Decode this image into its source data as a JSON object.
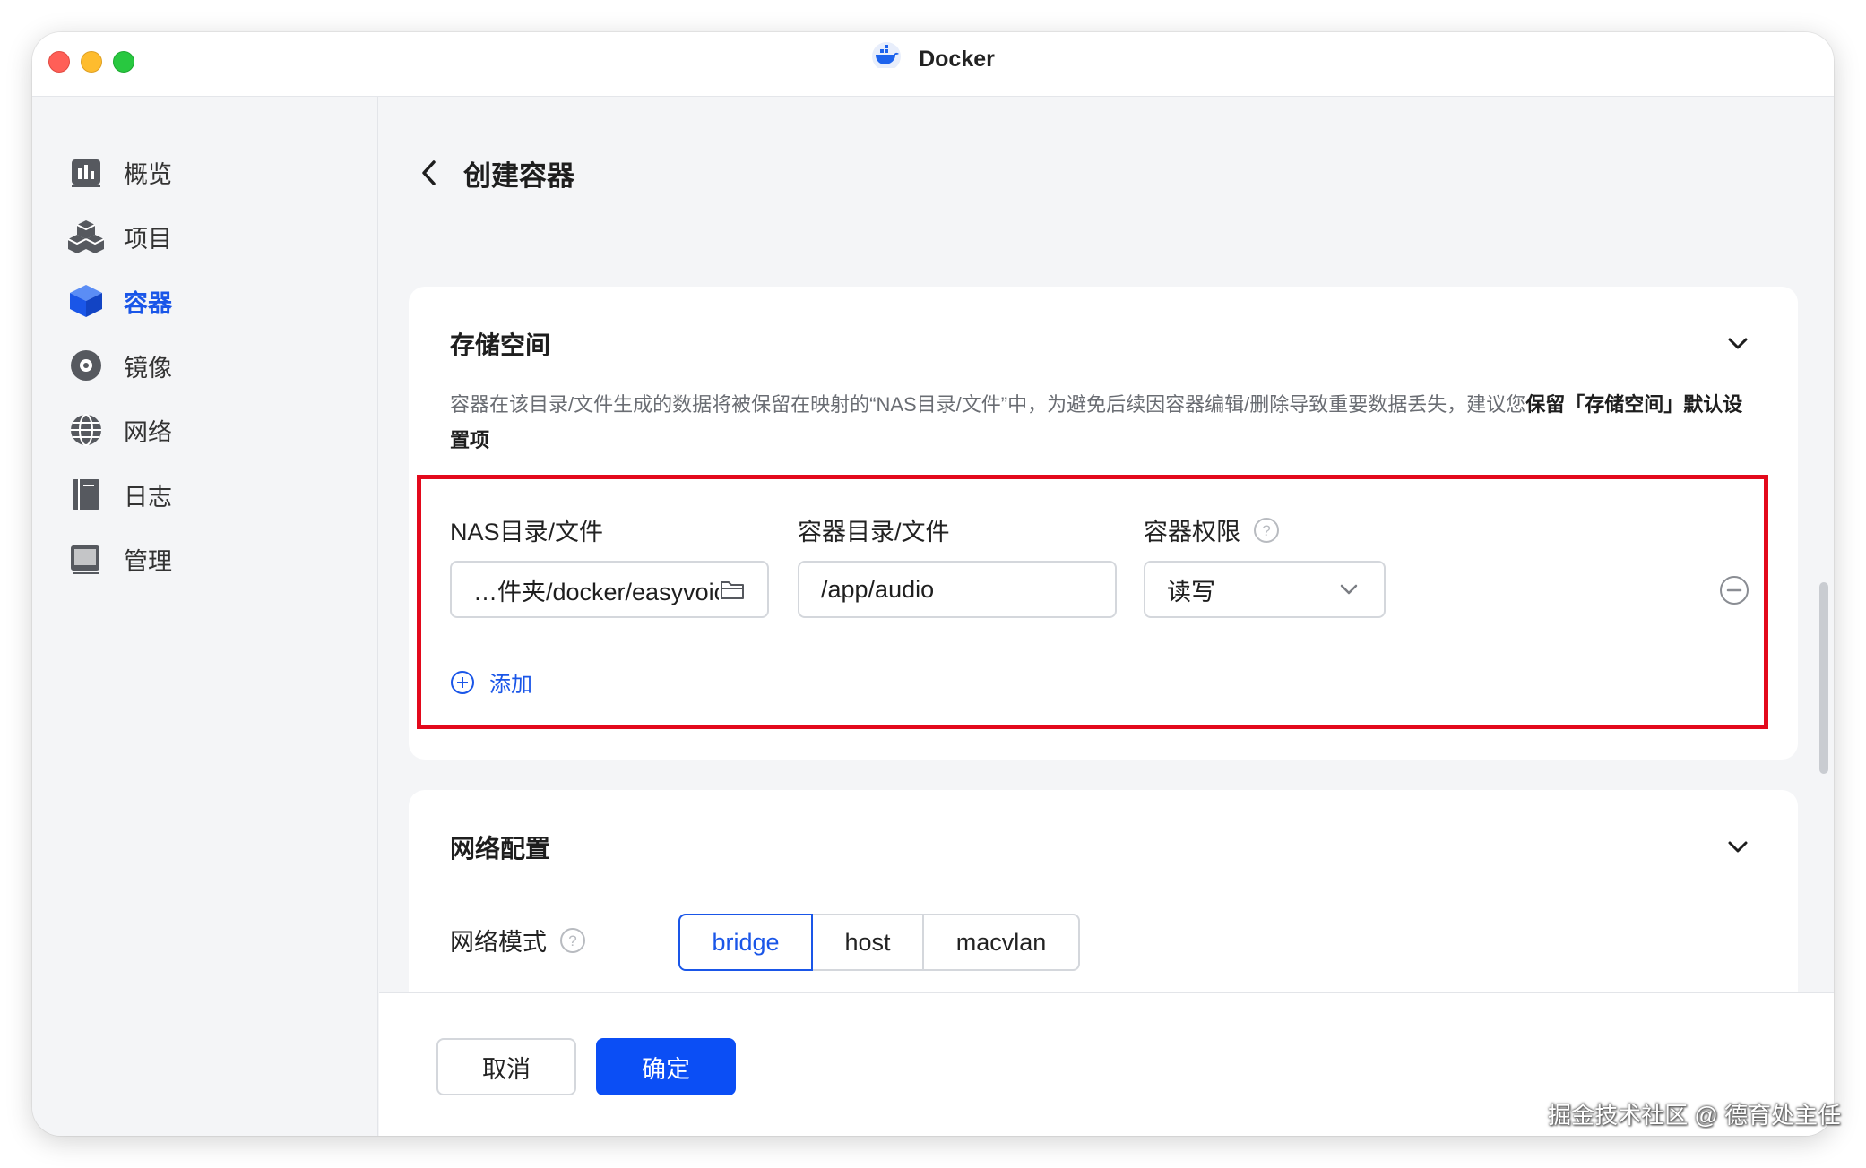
{
  "window": {
    "title": "Docker"
  },
  "sidebar": {
    "items": [
      {
        "label": "概览",
        "icon": "overview-icon"
      },
      {
        "label": "项目",
        "icon": "project-icon"
      },
      {
        "label": "容器",
        "icon": "container-icon",
        "active": true
      },
      {
        "label": "镜像",
        "icon": "image-icon"
      },
      {
        "label": "网络",
        "icon": "network-icon"
      },
      {
        "label": "日志",
        "icon": "log-icon"
      },
      {
        "label": "管理",
        "icon": "manage-icon"
      }
    ]
  },
  "header": {
    "title": "创建容器"
  },
  "storage": {
    "title": "存储空间",
    "description": "容器在该目录/文件生成的数据将被保留在映射的“NAS目录/文件”中，为避免后续因容器编辑/删除导致重要数据丢失，建议您",
    "description_bold": "保留「存储空间」默认设置项",
    "columns": {
      "nas": "NAS目录/文件",
      "container": "容器目录/文件",
      "permission": "容器权限"
    },
    "row": {
      "nas_path": "…件夹/docker/easyvoice/audio",
      "container_path": "/app/audio",
      "permission": "读写"
    },
    "add_label": "添加"
  },
  "network": {
    "title": "网络配置",
    "mode_label": "网络模式",
    "modes": [
      "bridge",
      "host",
      "macvlan"
    ],
    "selected_mode": "bridge"
  },
  "footer": {
    "cancel": "取消",
    "confirm": "确定"
  },
  "colors": {
    "accent": "#1a56e8",
    "primary_button": "#0b4ef5",
    "highlight_border": "#e3091c"
  },
  "watermark": "掘金技术社区 @ 德育处主任"
}
